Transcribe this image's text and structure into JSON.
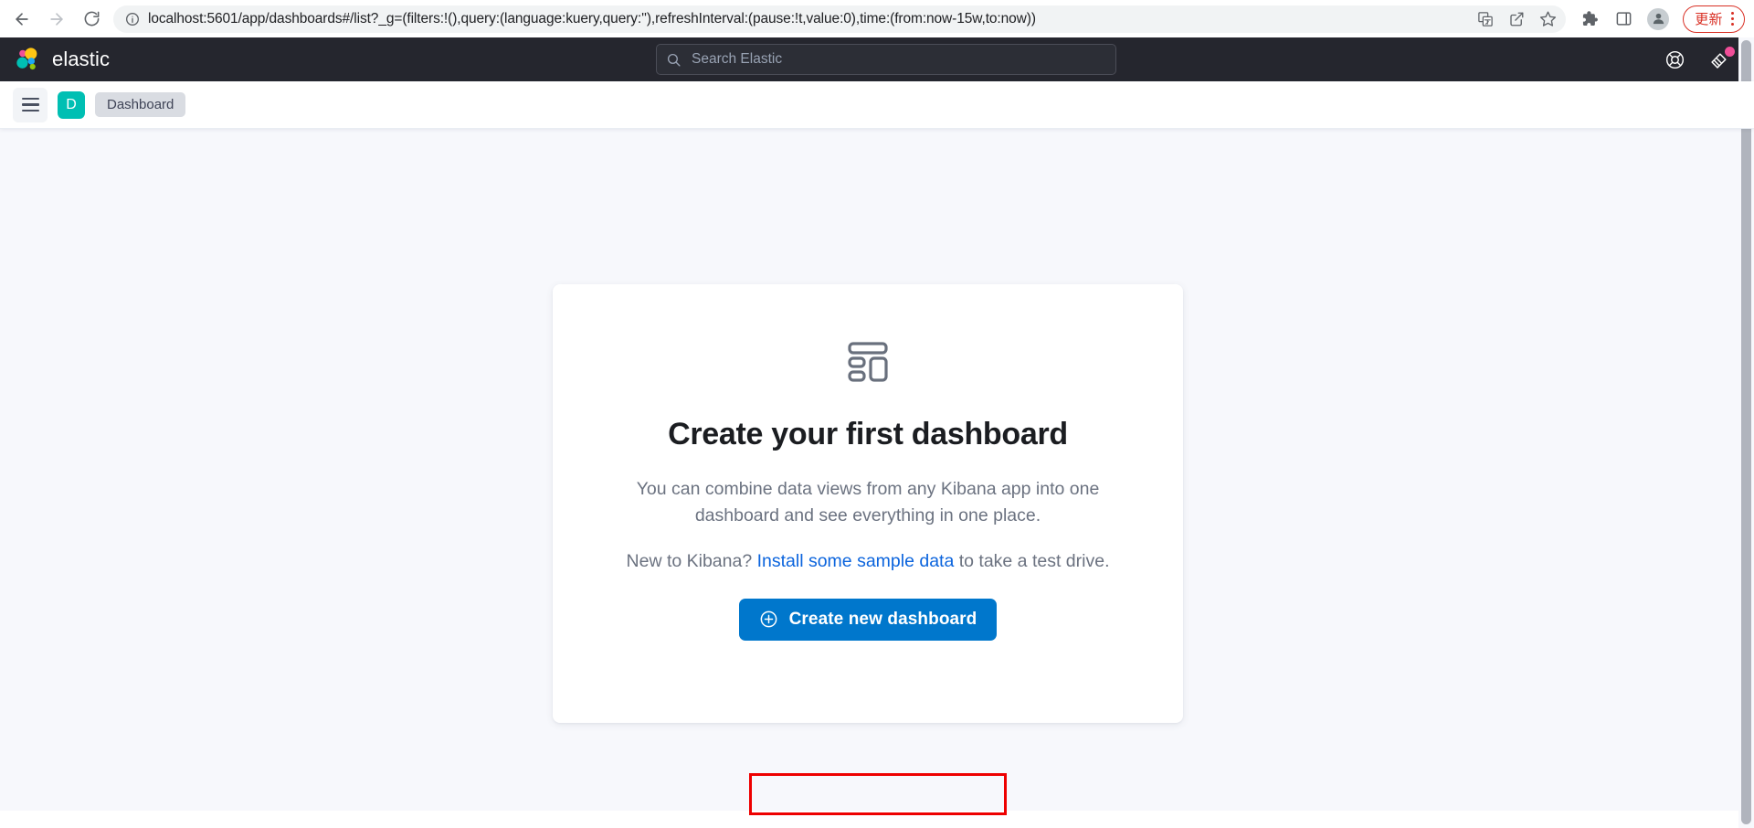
{
  "browser": {
    "back_icon": "back-arrow-icon",
    "forward_icon": "forward-arrow-icon",
    "reload_icon": "reload-icon",
    "site_info_icon": "site-info-icon",
    "url": "localhost:5601/app/dashboards#/list?_g=(filters:!(),query:(language:kuery,query:''),refreshInterval:(pause:!t,value:0),time:(from:now-15w,to:now))",
    "url_icons": [
      "translate-icon",
      "share-icon",
      "bookmark-star-icon"
    ],
    "toolbar_icons": [
      "extensions-puzzle-icon",
      "side-panel-icon",
      "profile-avatar-icon"
    ],
    "update_button_label": "更新",
    "menu_icon": "kebab-menu-icon"
  },
  "header": {
    "logo_icon": "elastic-logo-icon",
    "brand": "elastic",
    "search": {
      "icon": "search-icon",
      "placeholder": "Search Elastic",
      "value": ""
    },
    "help_icon": "help-lifebuoy-icon",
    "announcement_icon": "announcement-megaphone-icon",
    "has_notification": true
  },
  "subheader": {
    "menu_icon": "hamburger-menu-icon",
    "app_badge": "D",
    "breadcrumb": "Dashboard"
  },
  "main": {
    "illustration_icon": "dashboard-layout-icon",
    "title": "Create your first dashboard",
    "description": "You can combine data views from any Kibana app into one dashboard and see everything in one place.",
    "prompt_prefix": "New to Kibana? ",
    "prompt_link": "Install some sample data",
    "prompt_suffix": " to take a test drive.",
    "cta_label": "Create new dashboard",
    "cta_icon": "plus-circle-icon"
  },
  "annotation": {
    "type": "red-highlight-rectangle",
    "target": "create-new-dashboard-button"
  },
  "colors": {
    "accent_blue": "#0077CC",
    "link_blue": "#0B64DD",
    "brand_dark": "#25262E",
    "app_badge_teal": "#00BFB3",
    "notification_pink": "#F04E98",
    "annotation_red": "#EE0000",
    "update_red": "#D93025",
    "page_bg": "#F7F8FC"
  }
}
